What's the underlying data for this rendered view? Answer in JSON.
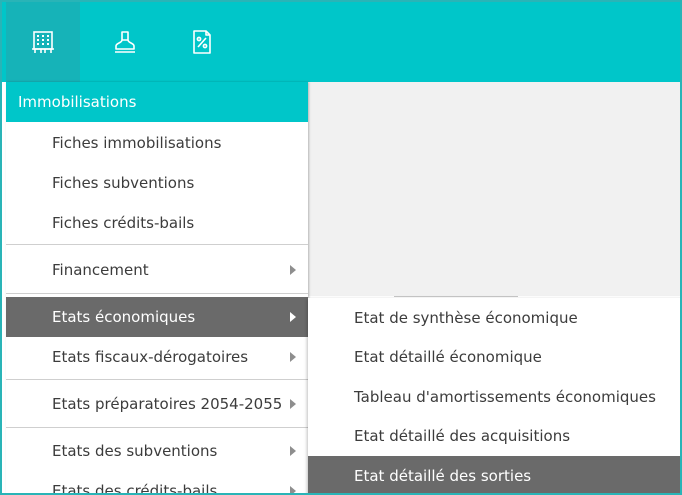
{
  "topbar": {
    "icons": [
      {
        "name": "building-icon",
        "active": true
      },
      {
        "name": "stamp-icon",
        "active": false
      },
      {
        "name": "percent-document-icon",
        "active": false
      }
    ]
  },
  "menu": {
    "header": "Immobilisations",
    "items": [
      {
        "label": "Fiches immobilisations",
        "submenu": false
      },
      {
        "label": "Fiches subventions",
        "submenu": false
      },
      {
        "label": "Fiches crédits-bails",
        "submenu": false
      },
      {
        "label": "Financement",
        "submenu": true
      },
      {
        "label": "Etats économiques",
        "submenu": true,
        "active": true
      },
      {
        "label": "Etats fiscaux-dérogatoires",
        "submenu": true
      },
      {
        "label": "Etats préparatoires 2054-2055",
        "submenu": true
      },
      {
        "label": "Etats des subventions",
        "submenu": true
      },
      {
        "label": "Etats des crédits-bails",
        "submenu": true
      }
    ]
  },
  "submenu": {
    "items": [
      {
        "label": "Etat de synthèse économique"
      },
      {
        "label": "Etat détaillé économique"
      },
      {
        "label": "Tableau d'amortissements économiques"
      },
      {
        "label": "Etat détaillé des acquisitions"
      },
      {
        "label": "Etat détaillé des sorties",
        "active": true
      }
    ]
  },
  "colors": {
    "accent": "#00c6c9",
    "active_tab": "#16b3b8",
    "highlight": "#6a6a6a",
    "text": "#3c3c3c"
  }
}
